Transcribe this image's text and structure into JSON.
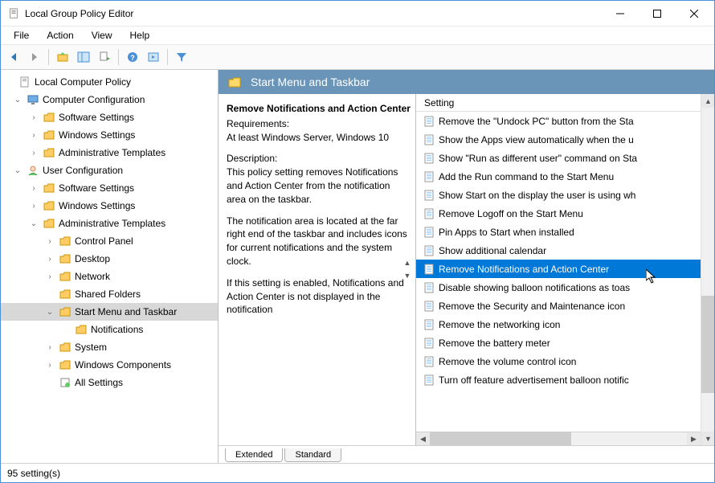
{
  "window": {
    "title": "Local Group Policy Editor"
  },
  "menu": {
    "file": "File",
    "action": "Action",
    "view": "View",
    "help": "Help"
  },
  "tree": {
    "root": "Local Computer Policy",
    "comp_cfg": "Computer Configuration",
    "user_cfg": "User Configuration",
    "sw_settings": "Software Settings",
    "win_settings": "Windows Settings",
    "admin_tmpl": "Administrative Templates",
    "control_panel": "Control Panel",
    "desktop": "Desktop",
    "network": "Network",
    "shared_folders": "Shared Folders",
    "startmenu": "Start Menu and Taskbar",
    "notifications": "Notifications",
    "system": "System",
    "win_components": "Windows Components",
    "all_settings": "All Settings"
  },
  "content": {
    "header": "Start Menu and Taskbar",
    "policy_title": "Remove Notifications and Action Center",
    "req_label": "Requirements:",
    "req_text": "At least Windows Server, Windows 10",
    "desc_label": "Description:",
    "desc_p1": "This policy setting removes Notifications and Action Center from the notification area on the taskbar.",
    "desc_p2": "The notification area is located at the far right end of the taskbar and includes icons for current notifications and the system clock.",
    "desc_p3": "If this setting is enabled, Notifications and Action Center is not displayed in the notification"
  },
  "settings": {
    "column_header": "Setting",
    "items": [
      "Remove the \"Undock PC\" button from the Sta",
      "Show the Apps view automatically when the u",
      "Show \"Run as different user\" command on Sta",
      "Add the Run command to the Start Menu",
      "Show Start on the display the user is using wh",
      "Remove Logoff on the Start Menu",
      "Pin Apps to Start when installed",
      "Show additional calendar",
      "Remove Notifications and Action Center",
      "Disable showing balloon notifications as toas",
      "Remove the Security and Maintenance icon",
      "Remove the networking icon",
      "Remove the battery meter",
      "Remove the volume control icon",
      "Turn off feature advertisement balloon notific"
    ],
    "selected_index": 8
  },
  "tabs": {
    "extended": "Extended",
    "standard": "Standard"
  },
  "status": {
    "text": "95 setting(s)"
  }
}
